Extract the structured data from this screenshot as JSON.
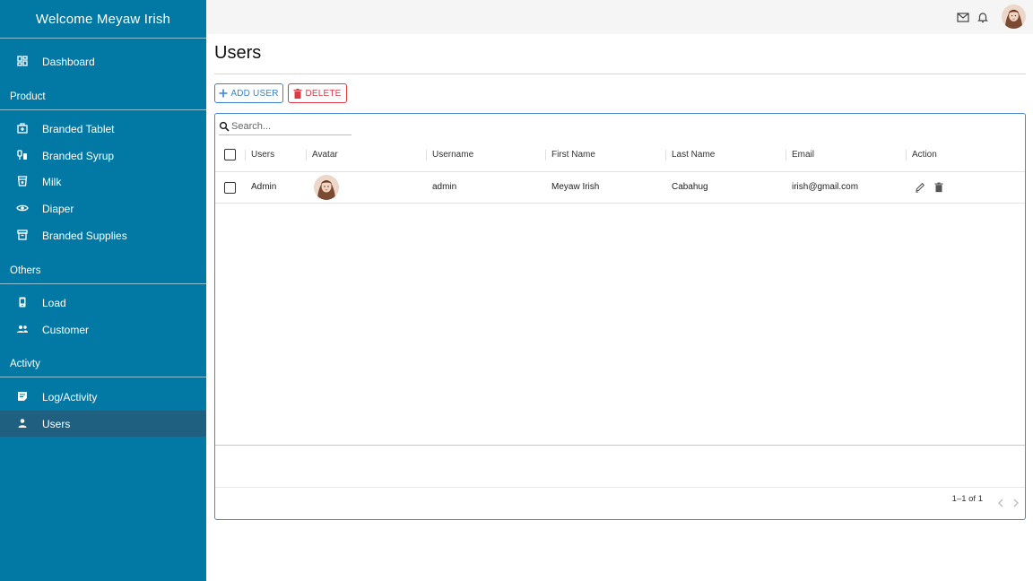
{
  "sidebar": {
    "welcome": "Welcome  Meyaw Irish",
    "items": [
      {
        "label": "Dashboard",
        "icon": "dashboard-icon"
      },
      {
        "label": "Branded Tablet",
        "icon": "medical-bag-icon"
      },
      {
        "label": "Branded Syrup",
        "icon": "syrup-icon"
      },
      {
        "label": "Milk",
        "icon": "milk-icon"
      },
      {
        "label": "Diaper",
        "icon": "eye-icon"
      },
      {
        "label": "Branded Supplies",
        "icon": "archive-icon"
      },
      {
        "label": "Load",
        "icon": "phone-icon"
      },
      {
        "label": "Customer",
        "icon": "people-icon"
      },
      {
        "label": "Log/Activity",
        "icon": "note-icon"
      },
      {
        "label": "Users",
        "icon": "person-icon"
      }
    ],
    "sections": [
      "Product",
      "Others",
      "Activty"
    ],
    "active_item": "Users"
  },
  "topbar": {
    "icons": [
      "mail-icon",
      "bell-icon"
    ],
    "avatar": "user-avatar"
  },
  "page": {
    "title": "Users",
    "add_label": "ADD USER",
    "delete_label": "DELETE"
  },
  "grid": {
    "search_placeholder": "Search...",
    "columns": [
      "Users",
      "Avatar",
      "Username",
      "First Name",
      "Last Name",
      "Email",
      "Action"
    ],
    "rows": [
      {
        "users": "Admin",
        "username": "admin",
        "first_name": "Meyaw Irish",
        "last_name": "Cabahug",
        "email": "irish@gmail.com"
      }
    ],
    "pagination": "1–1 of 1"
  },
  "colors": {
    "sidebar_bg": "#0279a4",
    "sidebar_active": "#1f5f80",
    "primary": "#3b82d6",
    "danger": "#e03945"
  }
}
